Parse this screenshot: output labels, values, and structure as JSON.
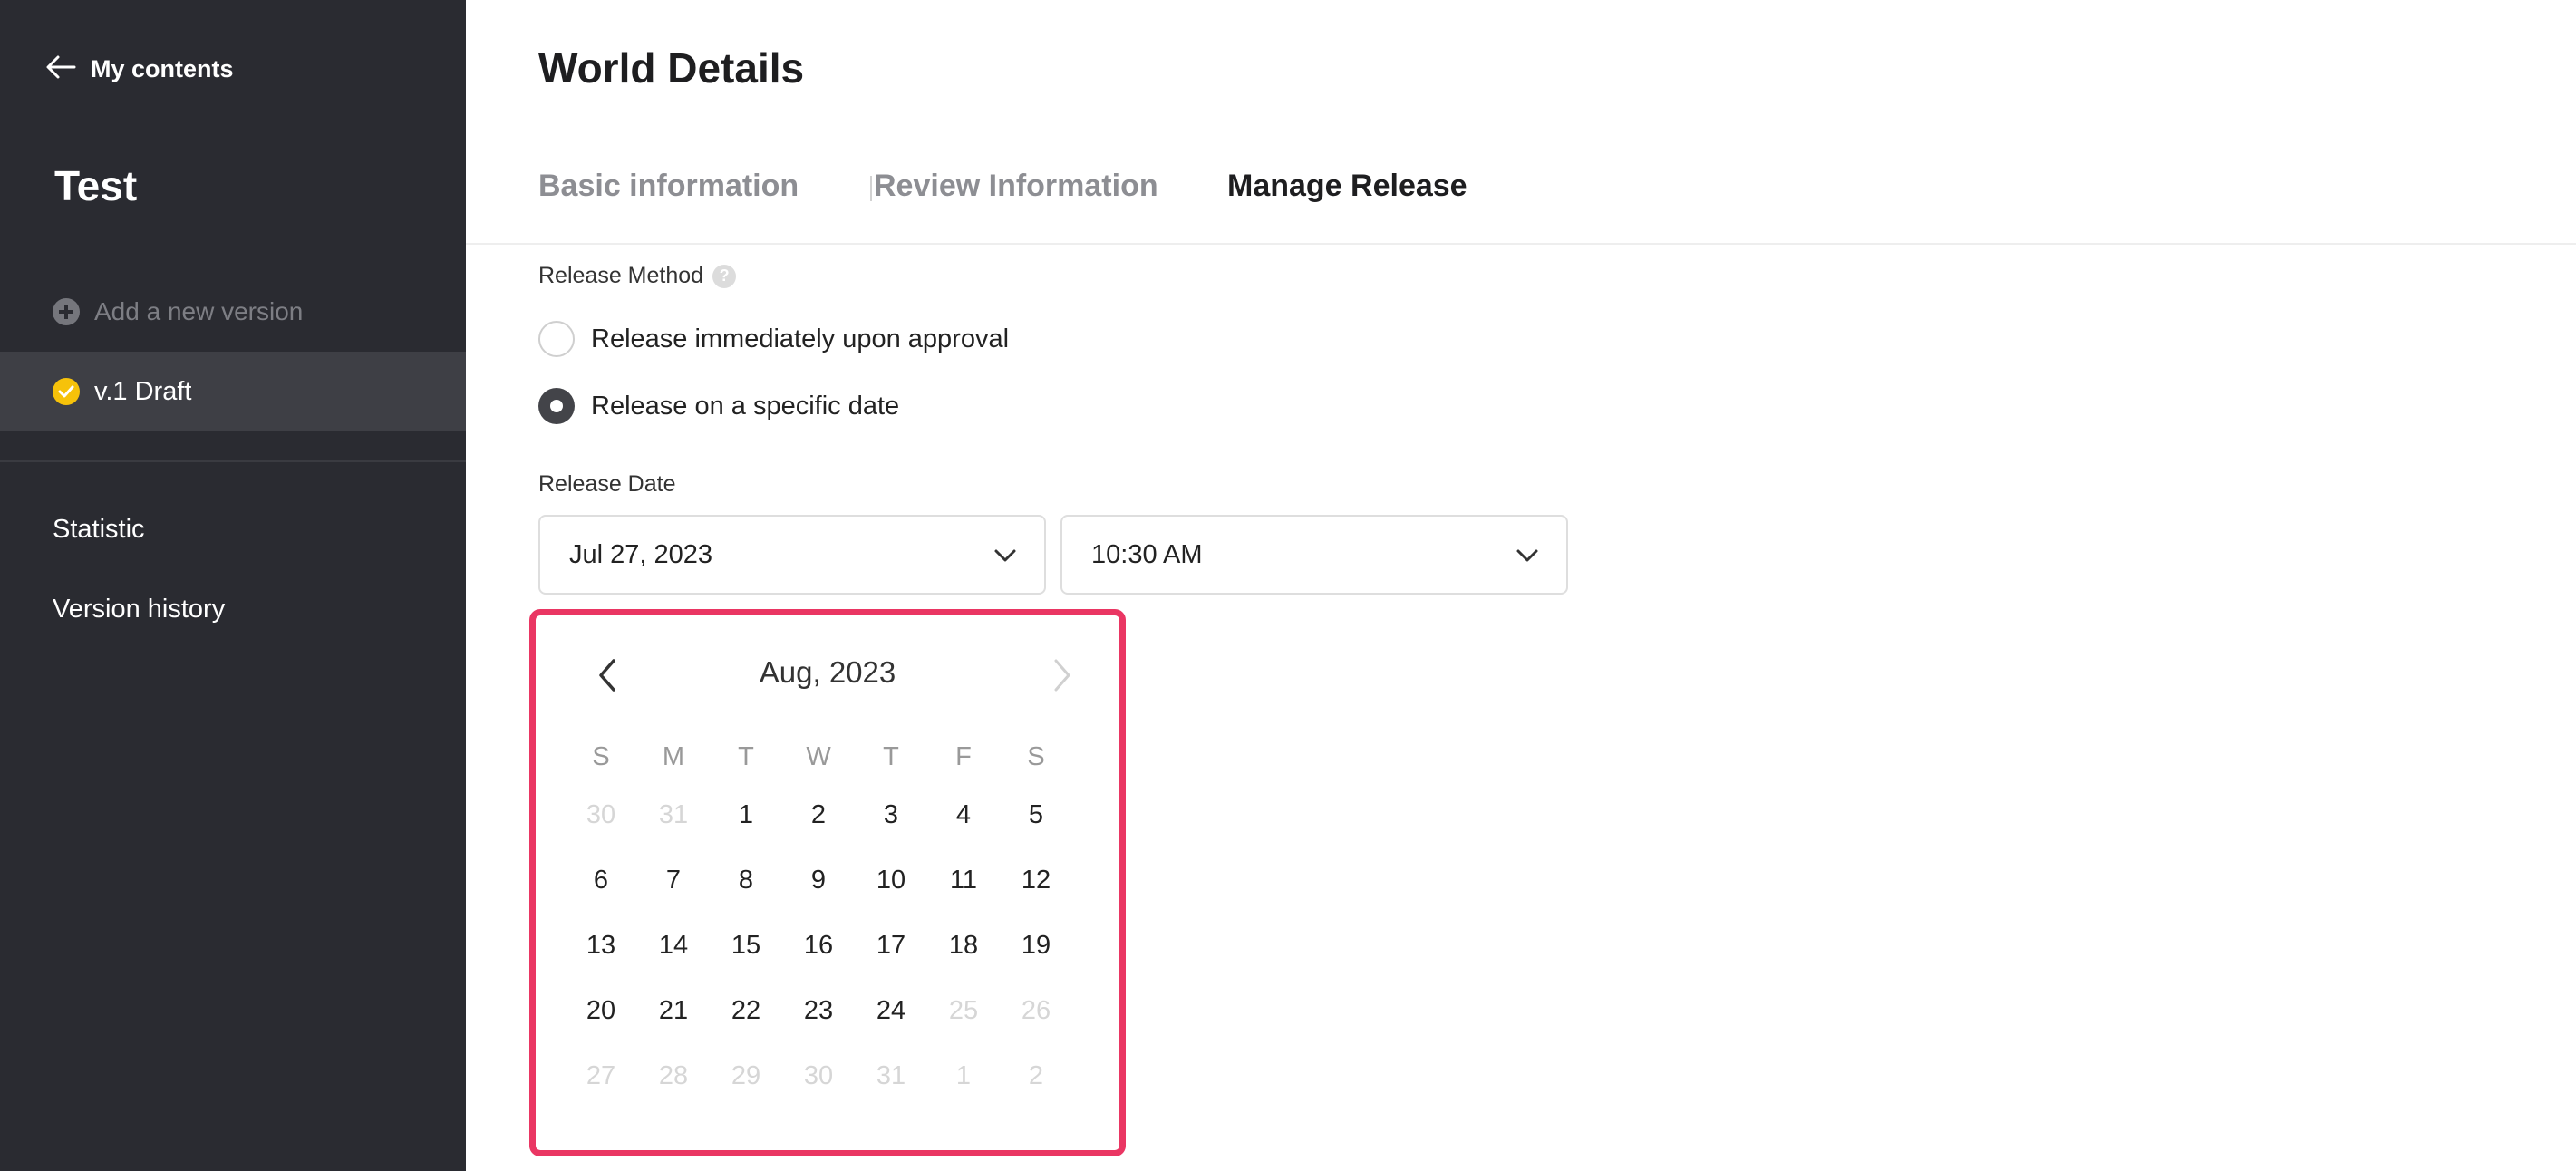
{
  "sidebar": {
    "back_label": "My contents",
    "project_title": "Test",
    "add_version_label": "Add a new version",
    "version_label": "v.1 Draft",
    "links": [
      "Statistic",
      "Version history"
    ]
  },
  "main": {
    "page_title": "World Details",
    "tabs": [
      {
        "label": "Basic information",
        "active": false
      },
      {
        "label": "Review Information",
        "active": false
      },
      {
        "label": "Manage Release",
        "active": true
      }
    ],
    "release_method": {
      "label": "Release Method",
      "help_icon": "question-icon",
      "options": [
        {
          "label": "Release immediately upon approval",
          "checked": false
        },
        {
          "label": "Release on a specific date",
          "checked": true
        }
      ]
    },
    "release_date": {
      "label": "Release Date",
      "date_value": "Jul 27, 2023",
      "time_value": "10:30 AM"
    }
  },
  "calendar": {
    "month_label": "Aug, 2023",
    "weekdays": [
      "S",
      "M",
      "T",
      "W",
      "T",
      "F",
      "S"
    ],
    "weeks": [
      [
        {
          "d": "30",
          "m": true
        },
        {
          "d": "31",
          "m": true
        },
        {
          "d": "1",
          "m": false
        },
        {
          "d": "2",
          "m": false
        },
        {
          "d": "3",
          "m": false
        },
        {
          "d": "4",
          "m": false
        },
        {
          "d": "5",
          "m": false
        }
      ],
      [
        {
          "d": "6",
          "m": false
        },
        {
          "d": "7",
          "m": false
        },
        {
          "d": "8",
          "m": false
        },
        {
          "d": "9",
          "m": false
        },
        {
          "d": "10",
          "m": false
        },
        {
          "d": "11",
          "m": false
        },
        {
          "d": "12",
          "m": false
        }
      ],
      [
        {
          "d": "13",
          "m": false
        },
        {
          "d": "14",
          "m": false
        },
        {
          "d": "15",
          "m": false
        },
        {
          "d": "16",
          "m": false
        },
        {
          "d": "17",
          "m": false
        },
        {
          "d": "18",
          "m": false
        },
        {
          "d": "19",
          "m": false
        }
      ],
      [
        {
          "d": "20",
          "m": false
        },
        {
          "d": "21",
          "m": false
        },
        {
          "d": "22",
          "m": false
        },
        {
          "d": "23",
          "m": false
        },
        {
          "d": "24",
          "m": false
        },
        {
          "d": "25",
          "m": true
        },
        {
          "d": "26",
          "m": true
        }
      ],
      [
        {
          "d": "27",
          "m": true
        },
        {
          "d": "28",
          "m": true
        },
        {
          "d": "29",
          "m": true
        },
        {
          "d": "30",
          "m": true
        },
        {
          "d": "31",
          "m": true
        },
        {
          "d": "1",
          "m": true
        },
        {
          "d": "2",
          "m": true
        }
      ]
    ]
  },
  "colors": {
    "sidebar_bg": "#2a2b31",
    "active_item_bg": "#3e3f45",
    "accent_yellow": "#f6c20a",
    "highlight_border": "#ea3663"
  }
}
